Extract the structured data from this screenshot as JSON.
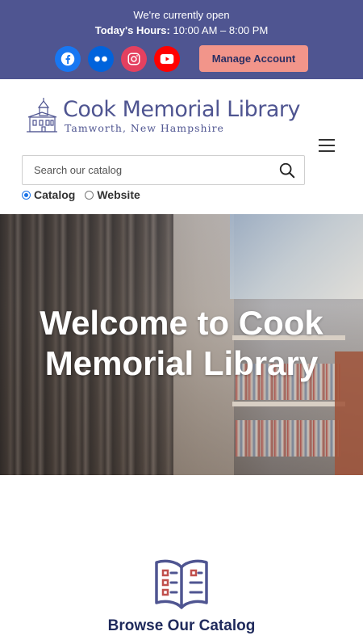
{
  "topbar": {
    "open_status": "We're currently open",
    "hours_label": "Today's Hours:",
    "hours_value": "10:00 AM – 8:00 PM",
    "social": [
      {
        "name": "facebook-icon",
        "color": "#1877f2"
      },
      {
        "name": "flickr-icon",
        "color": "#0063dc"
      },
      {
        "name": "instagram-icon",
        "color": "#e4405f"
      },
      {
        "name": "youtube-icon",
        "color": "#ff0000"
      }
    ],
    "manage_label": "Manage Account",
    "background": "#4f5591",
    "manage_bg": "#f2958a"
  },
  "header": {
    "logo_title": "Cook Memorial Library",
    "logo_subtitle": "Tamworth, New Hampshire"
  },
  "search": {
    "placeholder": "Search our catalog",
    "value": "",
    "options": [
      {
        "label": "Catalog",
        "checked": true
      },
      {
        "label": "Website",
        "checked": false
      }
    ]
  },
  "hero": {
    "title": "Welcome to Cook Memorial Library"
  },
  "browse": {
    "title": "Browse Our Catalog",
    "icon": "open-book-icon",
    "accent": "#4f5591",
    "accent2": "#c0504d"
  }
}
